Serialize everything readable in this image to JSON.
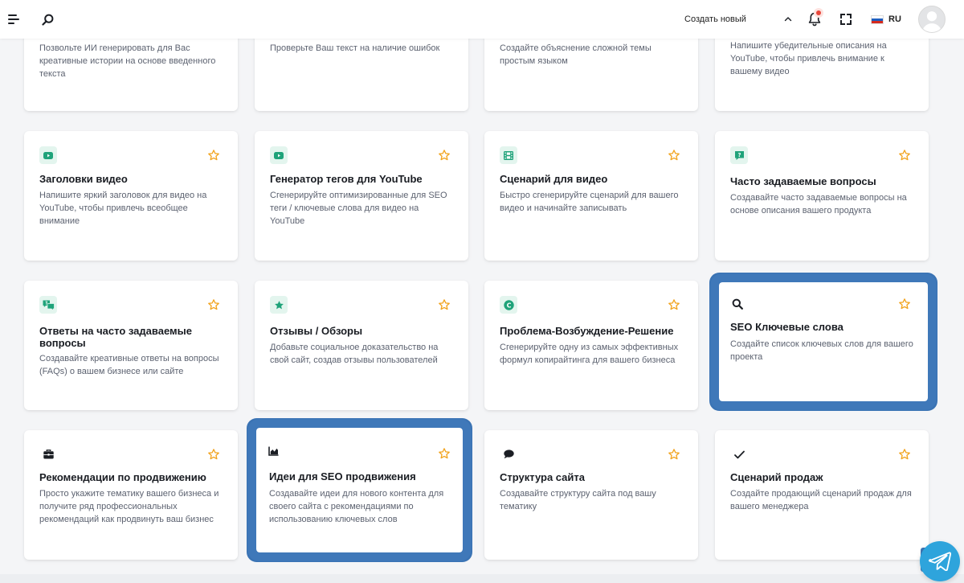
{
  "topbar": {
    "create_new_label": "Создать новый",
    "language": "RU",
    "menu_icon": "menu-icon",
    "search_icon": "search-icon",
    "bell_icon": "bell-icon",
    "fullscreen_icon": "fullscreen-icon",
    "notification_color": "#e8463a"
  },
  "colors": {
    "accent_green": "#1fa37a",
    "star": "#f2a41f",
    "selection_outline": "#3a73b4",
    "telegram": "#2ea4dc"
  },
  "cards": [
    {
      "title": "",
      "desc": "Позвольте ИИ генерировать для Вас креативные истории на основе введенного текста",
      "icon": ""
    },
    {
      "title": "",
      "desc": "Проверьте Ваш текст на наличие ошибок",
      "icon": ""
    },
    {
      "title": "",
      "desc": "Создайте объяснение сложной темы простым языком",
      "icon": ""
    },
    {
      "title": "",
      "desc": "Напишите убедительные описания на YouTube, чтобы привлечь внимание к вашему видео",
      "icon": ""
    },
    {
      "title": "Заголовки видео",
      "desc": "Напишите яркий заголовок для видео на YouTube, чтобы привлечь всеобщее внимание",
      "icon": "youtube-icon"
    },
    {
      "title": "Генератор тегов для YouTube",
      "desc": "Сгенерируйте оптимизированные для SEO теги / ключевые слова для видео на YouTube",
      "icon": "youtube-icon"
    },
    {
      "title": "Сценарий для видео",
      "desc": "Быстро сгенерируйте сценарий для вашего видео и начинайте записывать",
      "icon": "film-icon"
    },
    {
      "title": "Часто задаваемые вопросы",
      "desc": "Создавайте часто задаваемые вопросы на основе описания вашего продукта",
      "icon": "question-chat-icon"
    },
    {
      "title": "Ответы на часто задаваемые вопросы",
      "desc": "Создавайте креативные ответы на вопросы (FAQs) о вашем бизнесе или сайте",
      "icon": "faq-chat-icon"
    },
    {
      "title": "Отзывы / Обзоры",
      "desc": "Добавьте социальное доказательство на свой сайт, создав отзывы пользователей",
      "icon": "star-badge-icon"
    },
    {
      "title": "Проблема-Возбуждение-Решение",
      "desc": "Сгенерируйте одну из самых эффективных формул копирайтинга для вашего бизнеса",
      "icon": "copyright-icon"
    },
    {
      "title": "SEO Ключевые слова",
      "desc": "Создайте список ключевых слов для вашего проекта",
      "icon": "search-icon"
    },
    {
      "title": "Рекомендации по продвижению",
      "desc": "Просто укажите тематику вашего бизнеса и получите ряд профессиональных рекомендаций как продвинуть ваш бизнес",
      "icon": "briefcase-icon"
    },
    {
      "title": "Идеи для SEO продвижения",
      "desc": "Создавайте идеи для нового контента для своего сайта с рекомендациями по использованию ключевых слов",
      "icon": "area-chart-icon"
    },
    {
      "title": "Структура сайта",
      "desc": "Создавайте структуру сайта под вашу тематику",
      "icon": "comment-icon"
    },
    {
      "title": "Сценарий продаж",
      "desc": "Создайте продающий сценарий продаж для вашего менеджера",
      "icon": "check-icon"
    }
  ]
}
